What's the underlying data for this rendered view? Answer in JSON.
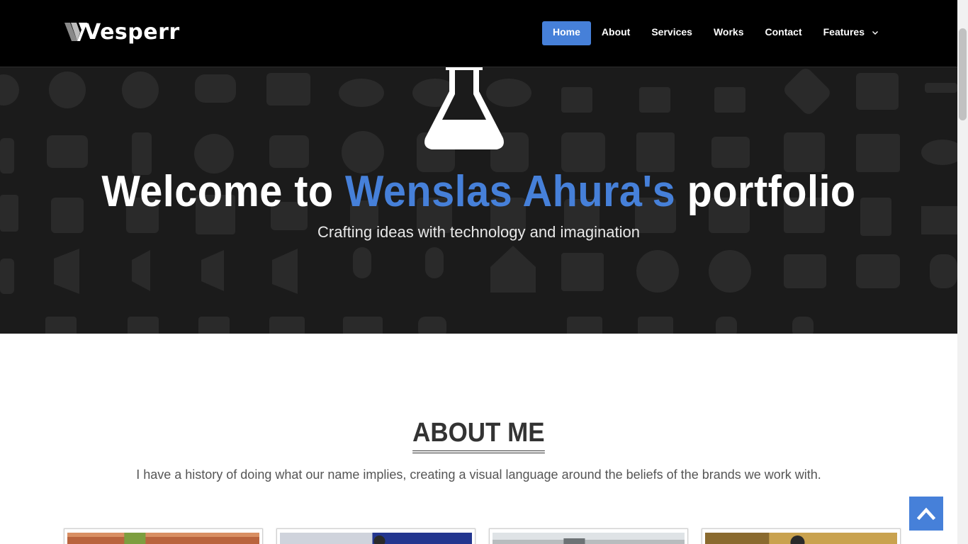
{
  "brand": {
    "name": "Vesperr"
  },
  "nav": {
    "items": [
      {
        "label": "Home",
        "active": true
      },
      {
        "label": "About",
        "active": false
      },
      {
        "label": "Services",
        "active": false
      },
      {
        "label": "Works",
        "active": false
      },
      {
        "label": "Contact",
        "active": false
      },
      {
        "label": "Features",
        "active": false,
        "has_dropdown": true
      }
    ]
  },
  "hero": {
    "icon": "flask-icon",
    "title_prefix": "Welcome to ",
    "title_accent": "Wenslas Ahura's",
    "title_suffix": " portfolio",
    "subtitle": "Crafting ideas with technology and imagination"
  },
  "about": {
    "title": "ABOUT ME",
    "text": "I have a history of doing what our name implies, creating a visual language around the beliefs of the brands we work with."
  },
  "back_to_top": {
    "icon": "chevron-up-icon"
  },
  "colors": {
    "accent": "#4680d9",
    "navbar_bg": "#000000",
    "hero_bg": "#1b1b1b",
    "heading": "#333333",
    "body_text": "#555555"
  }
}
